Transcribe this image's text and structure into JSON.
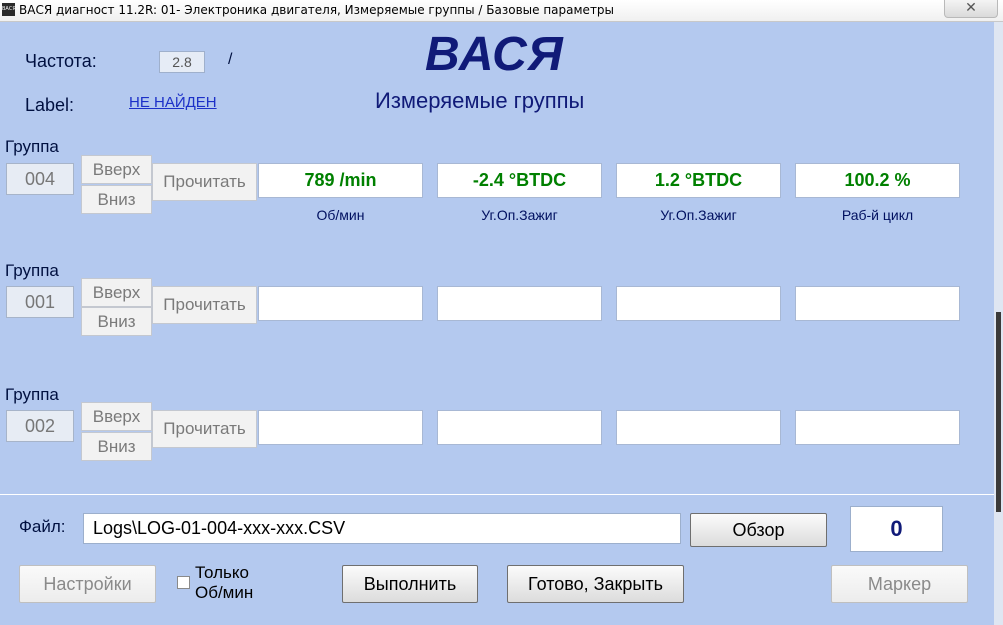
{
  "window": {
    "icon_text": "ВАСЯ",
    "title": "ВАСЯ диагност 11.2R: 01- Электроника двигателя,  Измеряемые группы / Базовые параметры",
    "close_glyph": "✕"
  },
  "header": {
    "freq_label": "Частота:",
    "freq_value": "2.8",
    "freq_sep": "/",
    "label_label": "Label:",
    "label_value": "НЕ НАЙДЕН",
    "app_title": "ВАСЯ",
    "subtitle": "Измеряемые группы"
  },
  "group_caption": "Группа",
  "buttons": {
    "up": "Вверх",
    "down": "Вниз",
    "read": "Прочитать"
  },
  "groups": [
    {
      "number": "004",
      "values": [
        "789 /min",
        "-2.4 °BTDC",
        "1.2 °BTDC",
        "100.2 %"
      ],
      "captions": [
        "Об/мин",
        "Уг.Оп.Зажиг",
        "Уг.Оп.Зажиг",
        "Раб-й цикл"
      ]
    },
    {
      "number": "001",
      "values": [
        "",
        "",
        "",
        ""
      ],
      "captions": [
        "",
        "",
        "",
        ""
      ]
    },
    {
      "number": "002",
      "values": [
        "",
        "",
        "",
        ""
      ],
      "captions": [
        "",
        "",
        "",
        ""
      ]
    }
  ],
  "footer": {
    "file_label": "Файл:",
    "file_path": "Logs\\LOG-01-004-xxx-xxx.CSV",
    "browse": "Обзор",
    "counter": "0",
    "settings": "Настройки",
    "only_rpm_line1": "Только",
    "only_rpm_line2": "Об/мин",
    "execute": "Выполнить",
    "done_close": "Готово, Закрыть",
    "marker": "Маркер"
  },
  "colors": {
    "background": "#b4c9ef",
    "title_blue": "#101a78",
    "value_green": "#008000",
    "link_blue": "#1c30c8"
  }
}
